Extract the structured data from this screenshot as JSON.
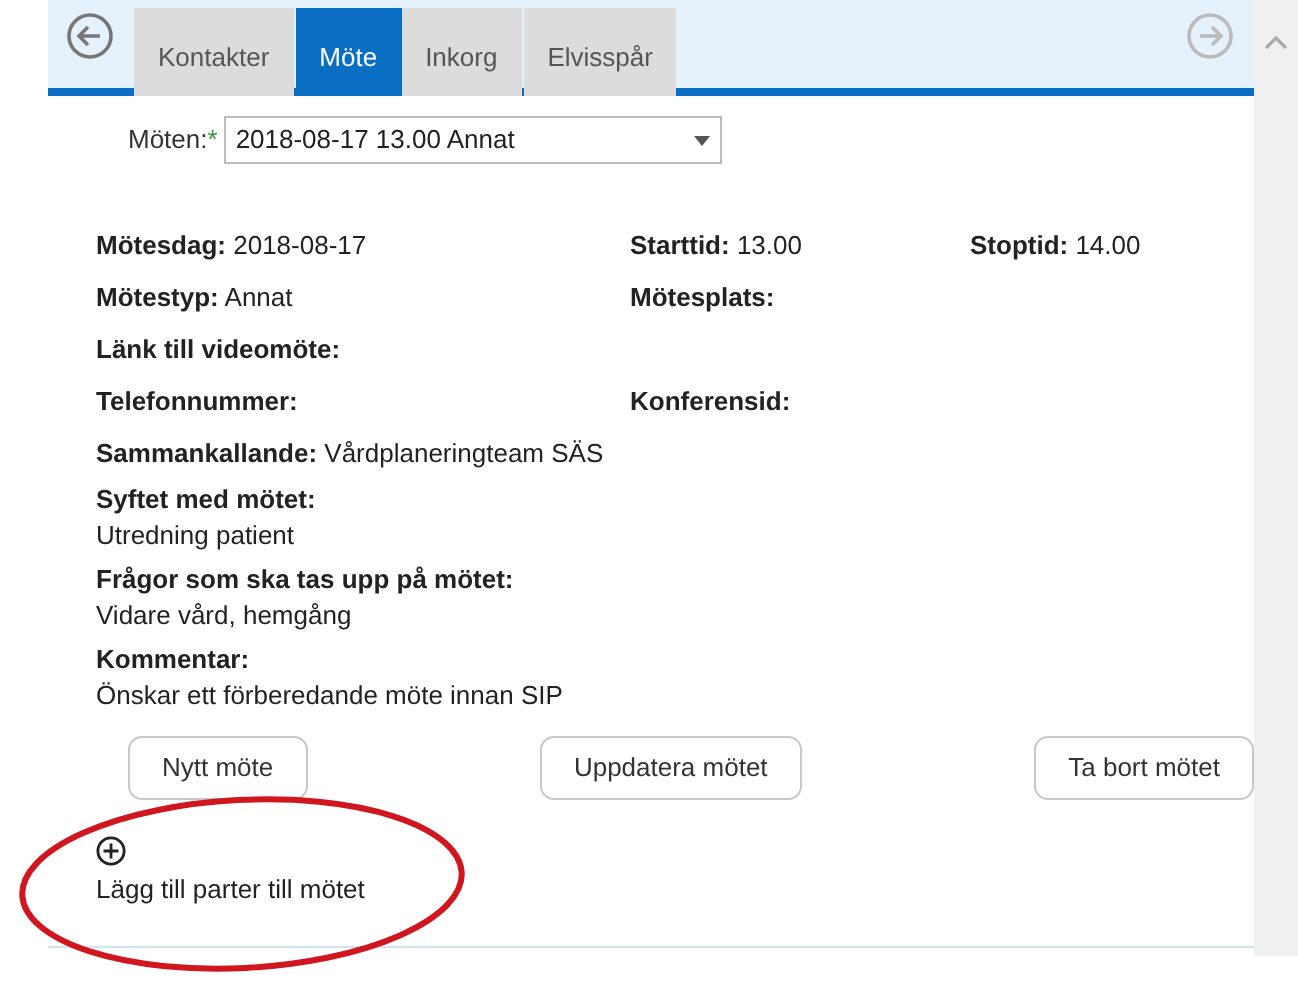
{
  "tabs": [
    {
      "label": "Kontakter",
      "selected": false
    },
    {
      "label": "Möte",
      "selected": true
    },
    {
      "label": "Inkorg",
      "selected": false
    },
    {
      "label": "Elvisspår",
      "selected": false
    }
  ],
  "meeting_select": {
    "label": "Möten:",
    "required_mark": "*",
    "value": "2018-08-17 13.00 Annat"
  },
  "field_rows": [
    [
      {
        "label": "Mötesdag:",
        "value": "2018-08-17"
      },
      {
        "label": "Starttid:",
        "value": "13.00"
      },
      {
        "label": "Stoptid:",
        "value": "14.00"
      }
    ],
    [
      {
        "label": "Mötestyp:",
        "value": "Annat"
      },
      {
        "label": "Mötesplats:"
      }
    ],
    [
      {
        "label": "Länk till videomöte:"
      }
    ],
    [
      {
        "label": "Telefonnummer:"
      },
      {
        "label": "Konferensid:"
      }
    ],
    [
      {
        "label": "Sammankallande:",
        "value": "Vårdplaneringteam SÄS"
      }
    ]
  ],
  "blocks": [
    {
      "label": "Syftet med mötet:",
      "value": "Utredning patient"
    },
    {
      "label": "Frågor som ska tas upp på mötet:",
      "value": "Vidare vård, hemgång"
    },
    {
      "label": "Kommentar:",
      "value": "Önskar ett förberedande möte innan SIP"
    }
  ],
  "buttons": [
    "Nytt möte",
    "Uppdatera mötet",
    "Ta bort mötet"
  ],
  "add_parties": {
    "label": "Lägg till parter till mötet"
  }
}
